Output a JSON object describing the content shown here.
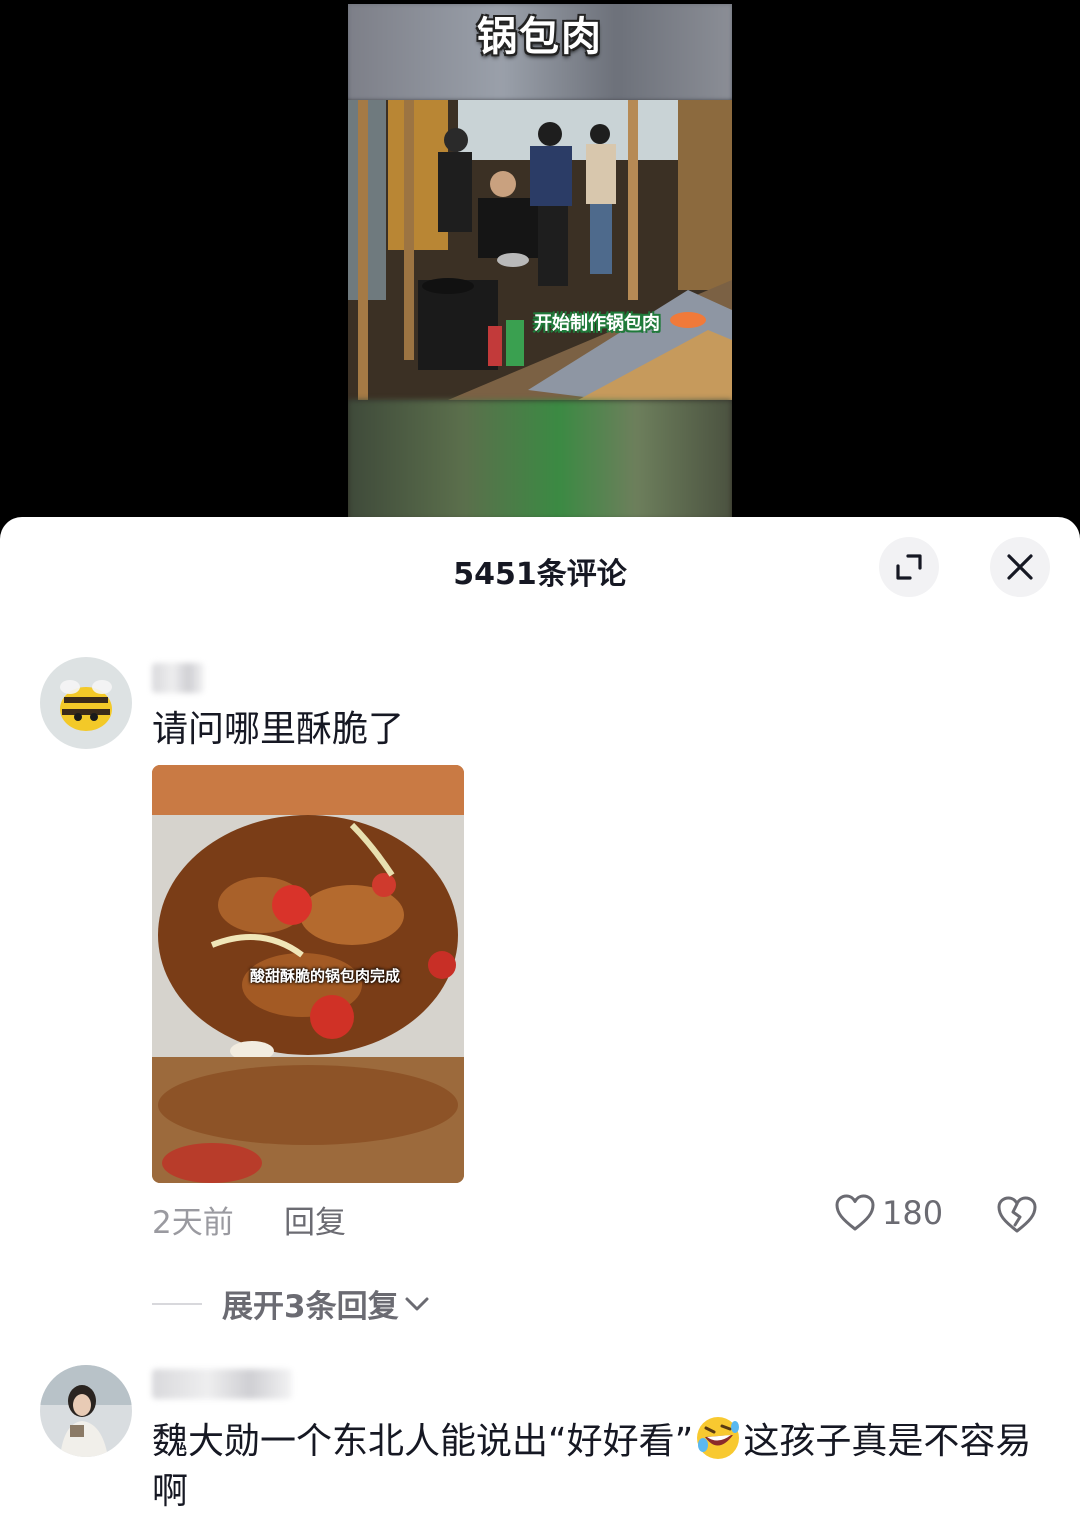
{
  "video": {
    "title_overlay": "锅包肉",
    "caption": "开始制作锅包肉"
  },
  "sheet": {
    "title": "5451条评论",
    "expand_icon": "expand-icon",
    "close_icon": "close-icon"
  },
  "comments": [
    {
      "text": "请问哪里酥脆了",
      "image_caption": "酸甜酥脆的锅包肉完成",
      "time": "2天前",
      "reply_label": "回复",
      "likes": "180",
      "expand_replies": "展开3条回复"
    },
    {
      "text_part1": "魏大勋一个东北人能说出“好好看”",
      "emoji": "rolling-on-floor-laughing-emoji",
      "text_part2": "这孩子真是不容易啊"
    }
  ]
}
